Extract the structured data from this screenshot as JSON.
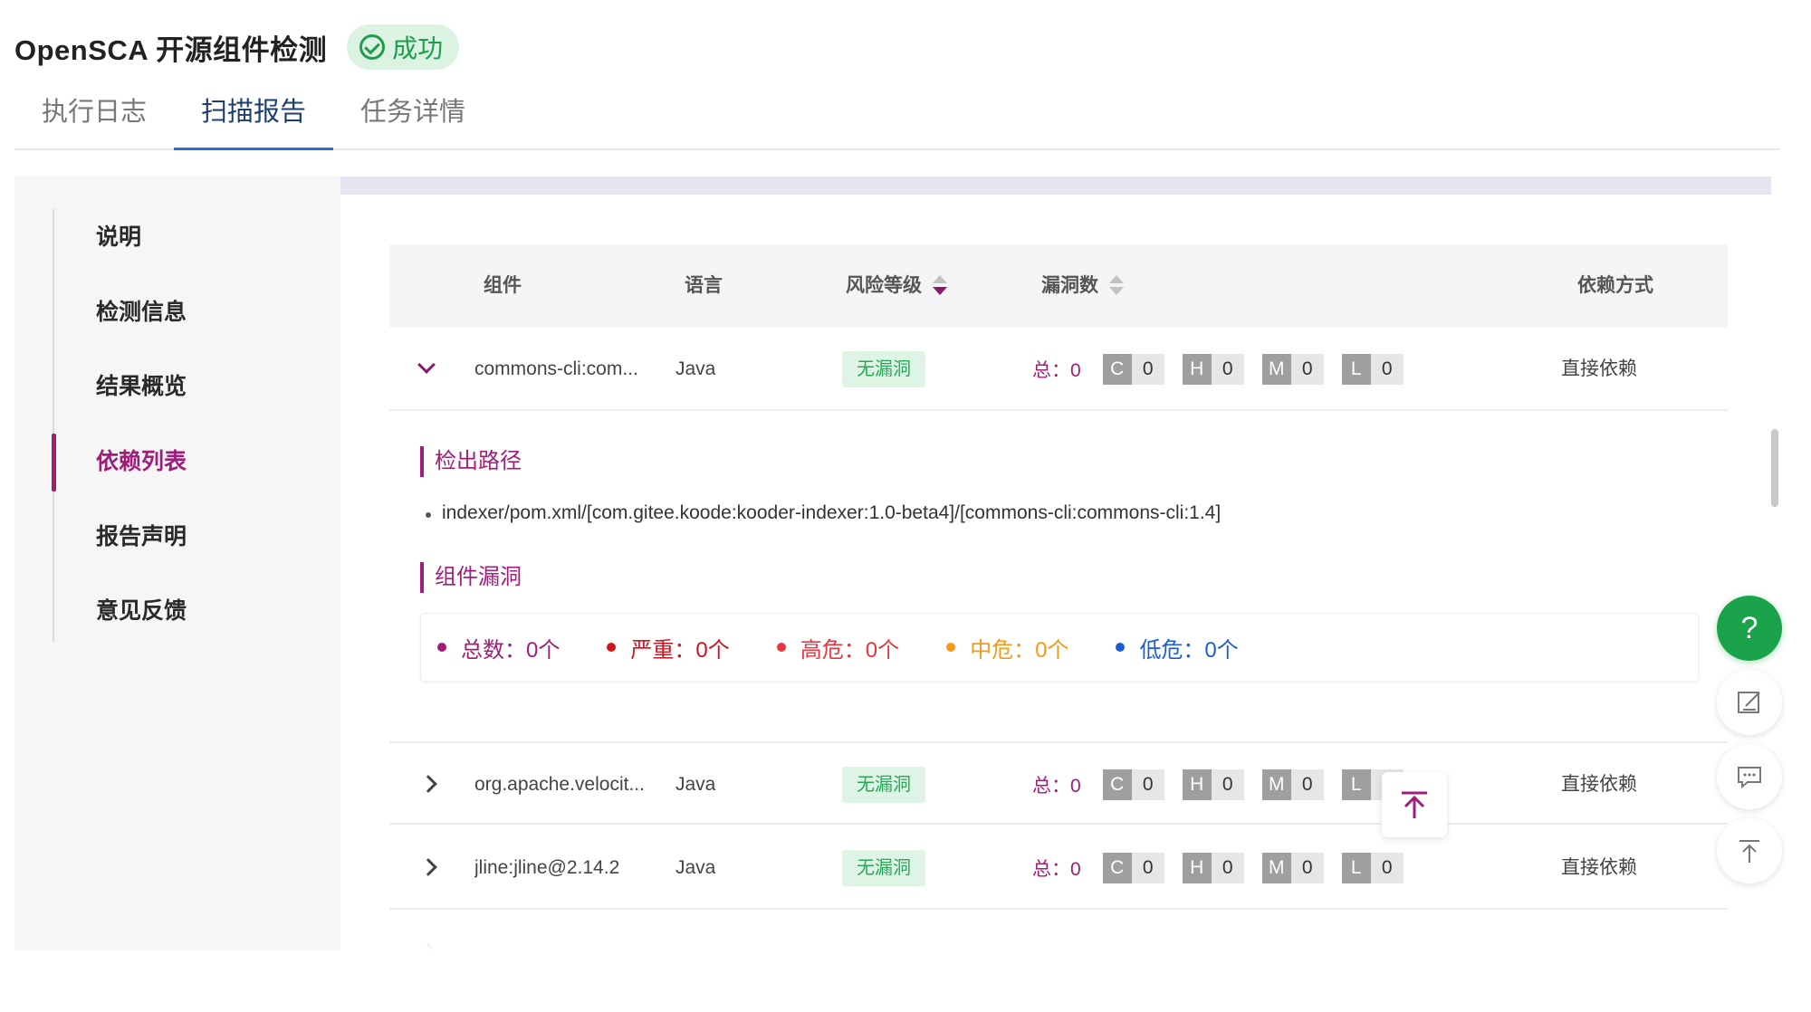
{
  "header": {
    "title": "OpenSCA 开源组件检测",
    "status": "成功",
    "status_icon": "check-circle-icon"
  },
  "tabs": [
    {
      "label": "执行日志",
      "active": false
    },
    {
      "label": "扫描报告",
      "active": true
    },
    {
      "label": "任务详情",
      "active": false
    }
  ],
  "sidebar": {
    "items": [
      {
        "label": "说明",
        "active": false
      },
      {
        "label": "检测信息",
        "active": false
      },
      {
        "label": "结果概览",
        "active": false
      },
      {
        "label": "依赖列表",
        "active": true
      },
      {
        "label": "报告声明",
        "active": false
      },
      {
        "label": "意见反馈",
        "active": false
      }
    ]
  },
  "table": {
    "headers": {
      "component": "组件",
      "language": "语言",
      "risk": "风险等级",
      "vulns": "漏洞数",
      "dependency": "依赖方式"
    },
    "risk_sort": "desc",
    "rows": [
      {
        "component": "commons-cli:com...",
        "language": "Java",
        "risk": "无漏洞",
        "total": "总：0",
        "C": "0",
        "H": "0",
        "M": "0",
        "L": "0",
        "dependency": "直接依赖",
        "expanded": true
      },
      {
        "component": "org.apache.velocit...",
        "language": "Java",
        "risk": "无漏洞",
        "total": "总：0",
        "C": "0",
        "H": "0",
        "M": "0",
        "L": "0",
        "dependency": "直接依赖",
        "expanded": false
      },
      {
        "component": "jline:jline@2.14.2",
        "language": "Java",
        "risk": "无漏洞",
        "total": "总：0",
        "C": "0",
        "H": "0",
        "M": "0",
        "L": "0",
        "dependency": "直接依赖",
        "expanded": false
      }
    ],
    "severity_keys": [
      "C",
      "H",
      "M",
      "L"
    ]
  },
  "detail": {
    "path_title": "检出路径",
    "path": "indexer/pom.xml/[com.gitee.koode:kooder-indexer:1.0-beta4]/[commons-cli:commons-cli:1.4]",
    "vuln_title": "组件漏洞",
    "stats": [
      {
        "label": "总数：0个",
        "color": "#a01e7a"
      },
      {
        "label": "严重：0个",
        "color": "#d0131f"
      },
      {
        "label": "高危：0个",
        "color": "#e8363f"
      },
      {
        "label": "中危：0个",
        "color": "#f39a1b"
      },
      {
        "label": "低危：0个",
        "color": "#1f5ccf"
      }
    ]
  },
  "colors": {
    "accent": "#a01e7a",
    "success": "#1aa34a",
    "tab_active": "#2b6fd6"
  },
  "floating": {
    "help_label": "?",
    "help_icon": "question-icon",
    "edit_icon": "edit-icon",
    "feedback_icon": "message-icon",
    "top_icon": "back-to-top-icon"
  }
}
